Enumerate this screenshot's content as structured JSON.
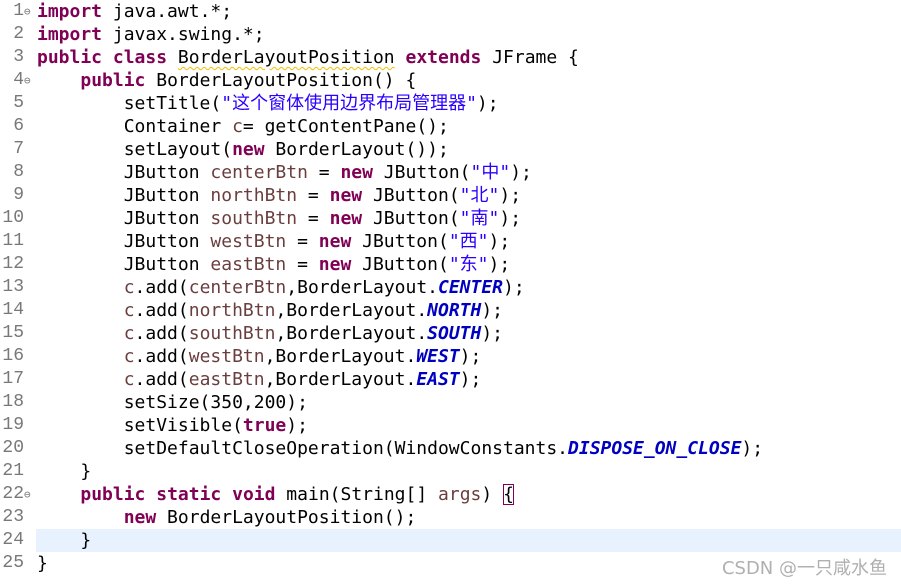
{
  "editor": {
    "lines": [
      {
        "num": "1",
        "fold": "⊖",
        "tokens": [
          {
            "t": "kw",
            "v": "import"
          },
          {
            "t": "p",
            "v": " java.awt.*;"
          }
        ]
      },
      {
        "num": "2",
        "fold": "",
        "tokens": [
          {
            "t": "kw",
            "v": "import"
          },
          {
            "t": "p",
            "v": " javax.swing.*;"
          }
        ]
      },
      {
        "num": "3",
        "fold": "",
        "tokens": [
          {
            "t": "kw",
            "v": "public"
          },
          {
            "t": "p",
            "v": " "
          },
          {
            "t": "kw",
            "v": "class"
          },
          {
            "t": "p",
            "v": " "
          },
          {
            "t": "sq",
            "v": "BorderLayoutPosition"
          },
          {
            "t": "p",
            "v": " "
          },
          {
            "t": "kw",
            "v": "extends"
          },
          {
            "t": "p",
            "v": " JFrame {"
          }
        ]
      },
      {
        "num": "4",
        "fold": "⊖",
        "tokens": [
          {
            "t": "p",
            "v": "    "
          },
          {
            "t": "kw",
            "v": "public"
          },
          {
            "t": "p",
            "v": " BorderLayoutPosition() {"
          }
        ]
      },
      {
        "num": "5",
        "fold": "",
        "tokens": [
          {
            "t": "p",
            "v": "        setTitle("
          },
          {
            "t": "str",
            "v": "\"这个窗体使用边界布局管理器\""
          },
          {
            "t": "p",
            "v": ");"
          }
        ]
      },
      {
        "num": "6",
        "fold": "",
        "tokens": [
          {
            "t": "p",
            "v": "        Container "
          },
          {
            "t": "var",
            "v": "c"
          },
          {
            "t": "p",
            "v": "= getContentPane();"
          }
        ]
      },
      {
        "num": "7",
        "fold": "",
        "tokens": [
          {
            "t": "p",
            "v": "        setLayout("
          },
          {
            "t": "kw",
            "v": "new"
          },
          {
            "t": "p",
            "v": " BorderLayout());"
          }
        ]
      },
      {
        "num": "8",
        "fold": "",
        "tokens": [
          {
            "t": "p",
            "v": "        JButton "
          },
          {
            "t": "var",
            "v": "centerBtn"
          },
          {
            "t": "p",
            "v": " = "
          },
          {
            "t": "kw",
            "v": "new"
          },
          {
            "t": "p",
            "v": " JButton("
          },
          {
            "t": "str",
            "v": "\"中\""
          },
          {
            "t": "p",
            "v": ");"
          }
        ]
      },
      {
        "num": "9",
        "fold": "",
        "tokens": [
          {
            "t": "p",
            "v": "        JButton "
          },
          {
            "t": "var",
            "v": "northBtn"
          },
          {
            "t": "p",
            "v": " = "
          },
          {
            "t": "kw",
            "v": "new"
          },
          {
            "t": "p",
            "v": " JButton("
          },
          {
            "t": "str",
            "v": "\"北\""
          },
          {
            "t": "p",
            "v": ");"
          }
        ]
      },
      {
        "num": "10",
        "fold": "",
        "tokens": [
          {
            "t": "p",
            "v": "        JButton "
          },
          {
            "t": "var",
            "v": "southBtn"
          },
          {
            "t": "p",
            "v": " = "
          },
          {
            "t": "kw",
            "v": "new"
          },
          {
            "t": "p",
            "v": " JButton("
          },
          {
            "t": "str",
            "v": "\"南\""
          },
          {
            "t": "p",
            "v": ");"
          }
        ]
      },
      {
        "num": "11",
        "fold": "",
        "tokens": [
          {
            "t": "p",
            "v": "        JButton "
          },
          {
            "t": "var",
            "v": "westBtn"
          },
          {
            "t": "p",
            "v": " = "
          },
          {
            "t": "kw",
            "v": "new"
          },
          {
            "t": "p",
            "v": " JButton("
          },
          {
            "t": "str",
            "v": "\"西\""
          },
          {
            "t": "p",
            "v": ");"
          }
        ]
      },
      {
        "num": "12",
        "fold": "",
        "tokens": [
          {
            "t": "p",
            "v": "        JButton "
          },
          {
            "t": "var",
            "v": "eastBtn"
          },
          {
            "t": "p",
            "v": " = "
          },
          {
            "t": "kw",
            "v": "new"
          },
          {
            "t": "p",
            "v": " JButton("
          },
          {
            "t": "str",
            "v": "\"东\""
          },
          {
            "t": "p",
            "v": ");"
          }
        ]
      },
      {
        "num": "13",
        "fold": "",
        "tokens": [
          {
            "t": "p",
            "v": "        "
          },
          {
            "t": "var",
            "v": "c"
          },
          {
            "t": "p",
            "v": ".add("
          },
          {
            "t": "var",
            "v": "centerBtn"
          },
          {
            "t": "p",
            "v": ",BorderLayout."
          },
          {
            "t": "const",
            "v": "CENTER"
          },
          {
            "t": "p",
            "v": ");"
          }
        ]
      },
      {
        "num": "14",
        "fold": "",
        "tokens": [
          {
            "t": "p",
            "v": "        "
          },
          {
            "t": "var",
            "v": "c"
          },
          {
            "t": "p",
            "v": ".add("
          },
          {
            "t": "var",
            "v": "northBtn"
          },
          {
            "t": "p",
            "v": ",BorderLayout."
          },
          {
            "t": "const",
            "v": "NORTH"
          },
          {
            "t": "p",
            "v": ");"
          }
        ]
      },
      {
        "num": "15",
        "fold": "",
        "tokens": [
          {
            "t": "p",
            "v": "        "
          },
          {
            "t": "var",
            "v": "c"
          },
          {
            "t": "p",
            "v": ".add("
          },
          {
            "t": "var",
            "v": "southBtn"
          },
          {
            "t": "p",
            "v": ",BorderLayout."
          },
          {
            "t": "const",
            "v": "SOUTH"
          },
          {
            "t": "p",
            "v": ");"
          }
        ]
      },
      {
        "num": "16",
        "fold": "",
        "tokens": [
          {
            "t": "p",
            "v": "        "
          },
          {
            "t": "var",
            "v": "c"
          },
          {
            "t": "p",
            "v": ".add("
          },
          {
            "t": "var",
            "v": "westBtn"
          },
          {
            "t": "p",
            "v": ",BorderLayout."
          },
          {
            "t": "const",
            "v": "WEST"
          },
          {
            "t": "p",
            "v": ");"
          }
        ]
      },
      {
        "num": "17",
        "fold": "",
        "tokens": [
          {
            "t": "p",
            "v": "        "
          },
          {
            "t": "var",
            "v": "c"
          },
          {
            "t": "p",
            "v": ".add("
          },
          {
            "t": "var",
            "v": "eastBtn"
          },
          {
            "t": "p",
            "v": ",BorderLayout."
          },
          {
            "t": "const",
            "v": "EAST"
          },
          {
            "t": "p",
            "v": ");"
          }
        ]
      },
      {
        "num": "18",
        "fold": "",
        "tokens": [
          {
            "t": "p",
            "v": "        setSize(350,200);"
          }
        ]
      },
      {
        "num": "19",
        "fold": "",
        "tokens": [
          {
            "t": "p",
            "v": "        setVisible("
          },
          {
            "t": "kw",
            "v": "true"
          },
          {
            "t": "p",
            "v": ");"
          }
        ]
      },
      {
        "num": "20",
        "fold": "",
        "tokens": [
          {
            "t": "p",
            "v": "        setDefaultCloseOperation(WindowConstants."
          },
          {
            "t": "const",
            "v": "DISPOSE_ON_CLOSE"
          },
          {
            "t": "p",
            "v": ");"
          }
        ]
      },
      {
        "num": "21",
        "fold": "",
        "tokens": [
          {
            "t": "p",
            "v": "    }"
          }
        ]
      },
      {
        "num": "22",
        "fold": "⊖",
        "tokens": [
          {
            "t": "p",
            "v": "    "
          },
          {
            "t": "kw",
            "v": "public"
          },
          {
            "t": "p",
            "v": " "
          },
          {
            "t": "kw",
            "v": "static"
          },
          {
            "t": "p",
            "v": " "
          },
          {
            "t": "kw",
            "v": "void"
          },
          {
            "t": "p",
            "v": " main(String[] "
          },
          {
            "t": "param",
            "v": "args"
          },
          {
            "t": "p",
            "v": ") "
          },
          {
            "t": "box",
            "v": "{"
          }
        ]
      },
      {
        "num": "23",
        "fold": "",
        "tokens": [
          {
            "t": "p",
            "v": "        "
          },
          {
            "t": "kw",
            "v": "new"
          },
          {
            "t": "p",
            "v": " BorderLayoutPosition();"
          }
        ]
      },
      {
        "num": "24",
        "fold": "",
        "current": true,
        "tokens": [
          {
            "t": "p",
            "v": "    }"
          }
        ]
      },
      {
        "num": "25",
        "fold": "",
        "tokens": [
          {
            "t": "p",
            "v": "}"
          }
        ]
      }
    ]
  },
  "watermark": "CSDN @一只咸水鱼",
  "colors": {
    "keyword": "#7f0055",
    "string": "#2a00ff",
    "local_var": "#6a3e3e",
    "constant": "#0000c0",
    "current_line": "#e8f2fe",
    "line_number": "#787878"
  }
}
